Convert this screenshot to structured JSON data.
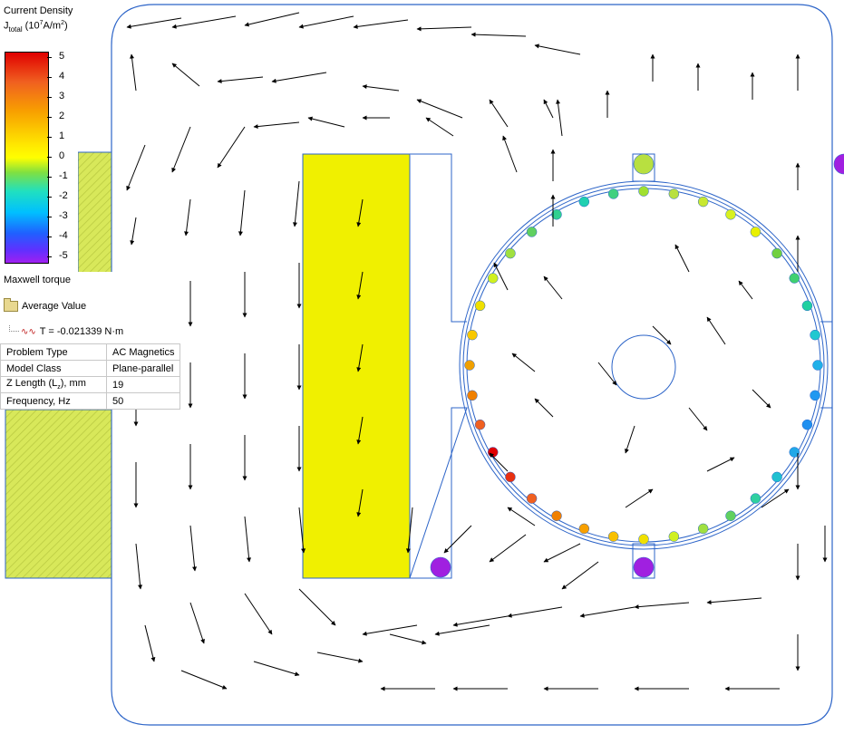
{
  "legend": {
    "title": "Current Density",
    "quantity": "J",
    "quantity_sub": "total",
    "unit_prefix": " (10",
    "unit_exp": "7",
    "unit_mid": "A/m",
    "unit_exp2": "2",
    "unit_suffix": ")",
    "ticks": [
      "5",
      "4",
      "3",
      "2",
      "1",
      "0",
      "-1",
      "-2",
      "-3",
      "-4",
      "-5"
    ]
  },
  "torque": {
    "title": "Maxwell torque",
    "group_label": "Average Value",
    "value_text": "T = -0.021339 N·m"
  },
  "properties": {
    "rows": [
      {
        "key": "Problem Type",
        "value": "AC Magnetics"
      },
      {
        "key": "Model Class",
        "value": "Plane-parallel"
      },
      {
        "key": "Z Length (L",
        "key_sub": "z",
        "key_suffix": "), mm",
        "value": "19"
      },
      {
        "key": "Frequency, Hz",
        "value": "50"
      }
    ]
  },
  "colors": {
    "outline": "#2c64c8",
    "coil": "#f0f000",
    "coil_hatch": "#d0e070",
    "conductor_purple": "#a020e0",
    "conductor_green": "#b8e040",
    "arrow": "#000000"
  }
}
